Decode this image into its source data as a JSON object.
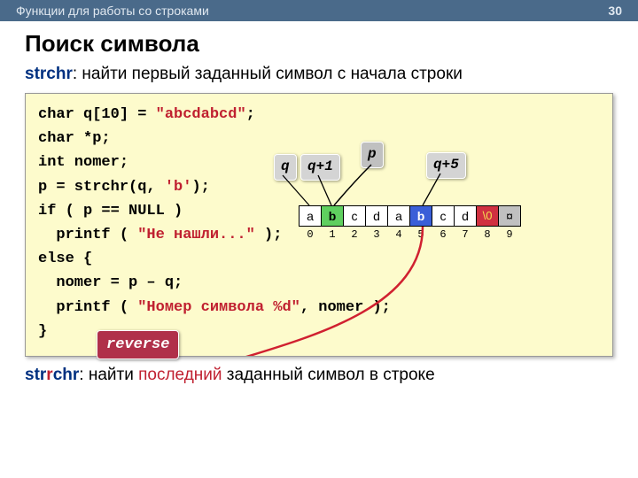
{
  "header": {
    "breadcrumb": "Функции для работы со строками",
    "page": "30"
  },
  "title": "Поиск символа",
  "intro": {
    "fn": "strchr",
    "rest": ": найти первый заданный символ c начала строки"
  },
  "code": {
    "l1_a": "char q[10] = ",
    "l1_b": "\"abcdabcd\"",
    "l1_c": ";",
    "l2": "char *p;",
    "l3": "int nomer;",
    "l4_a": "p = strchr(q, ",
    "l4_b": "'b'",
    "l4_c": ");",
    "l5": "if ( p == NULL )",
    "l6_a": "  printf ( ",
    "l6_b": "\"Не нашли...\"",
    "l6_c": " );",
    "l7": "else {",
    "l8": "  nomer = p – q;",
    "l9_a": "  printf ( ",
    "l9_b": "\"Номер символа %d\"",
    "l9_c": ", nomer );",
    "l10": "}"
  },
  "ptr": {
    "q": "q",
    "q1": "q+1",
    "p": "p",
    "q5": "q+5"
  },
  "mem": {
    "cells": [
      "a",
      "b",
      "c",
      "d",
      "a",
      "b",
      "c",
      "d",
      "\\0",
      "¤"
    ],
    "idx": [
      "0",
      "1",
      "2",
      "3",
      "4",
      "5",
      "6",
      "7",
      "8",
      "9"
    ]
  },
  "reverse": "reverse",
  "outro": {
    "fn_pre": "str",
    "fn_accent": "r",
    "fn_post": "chr",
    "rest1": ": найти ",
    "last": "последний",
    "rest2": " заданный символ в строке"
  }
}
